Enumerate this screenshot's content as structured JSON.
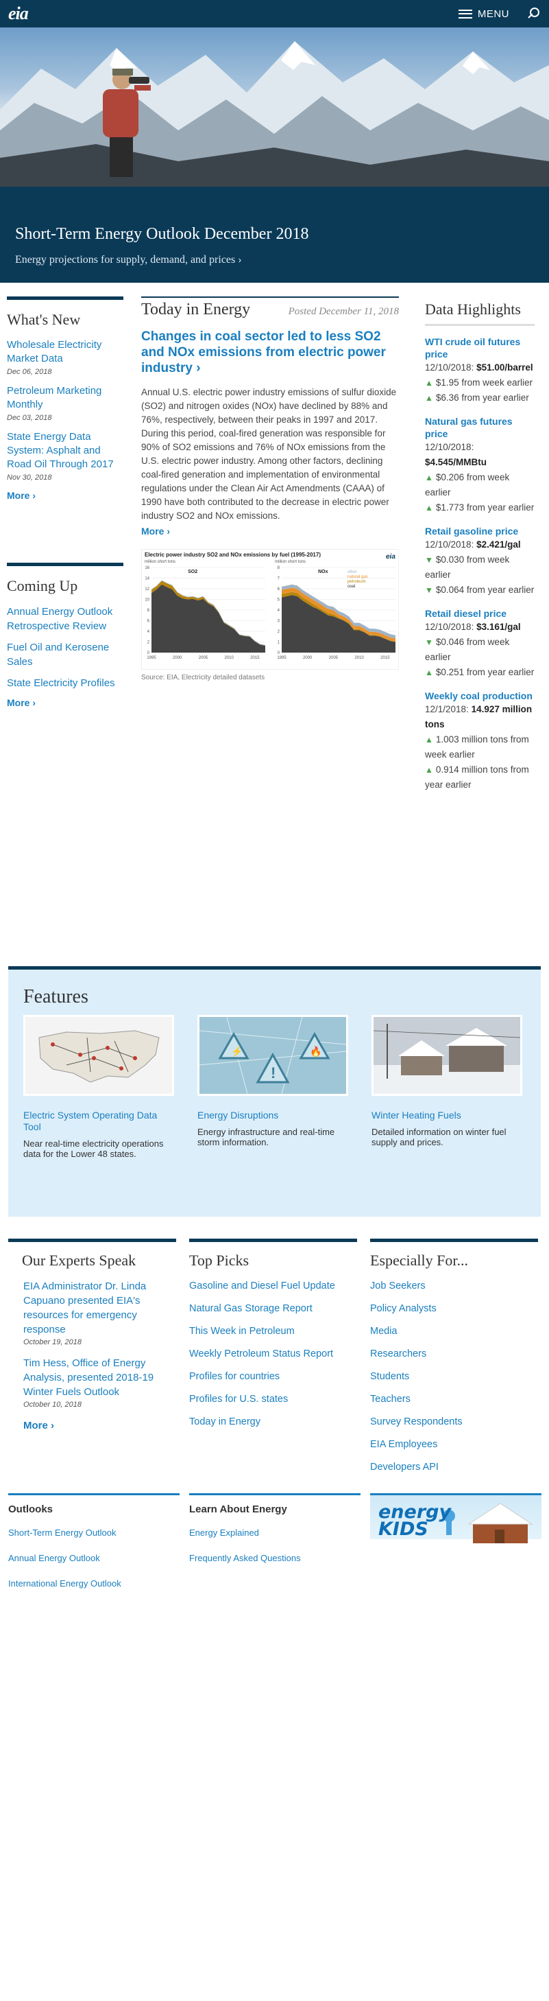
{
  "header": {
    "logo": "eia",
    "menu_label": "MENU"
  },
  "hero": {
    "title": "Short-Term Energy Outlook December 2018",
    "subtitle": "Energy projections for supply, demand, and prices ›",
    "slides": 6,
    "active_slide": 1
  },
  "whats_new": {
    "title": "What's New",
    "items": [
      {
        "label": "Wholesale Electricity Market Data",
        "date": "Dec 06, 2018"
      },
      {
        "label": "Petroleum Marketing Monthly",
        "date": "Dec 03, 2018"
      },
      {
        "label": "State Energy Data System: Asphalt and Road Oil Through 2017",
        "date": "Nov 30, 2018"
      }
    ],
    "more": "More ›"
  },
  "coming_up": {
    "title": "Coming Up",
    "items": [
      "Annual Energy Outlook Retrospective Review",
      "Fuel Oil and Kerosene Sales",
      "State Electricity Profiles"
    ],
    "more": "More ›"
  },
  "today": {
    "title": "Today in Energy",
    "posted": "Posted December 11, 2018",
    "headline": "Changes in coal sector led to less SO2 and NOx emissions from electric power industry ›",
    "body": "Annual U.S. electric power industry emissions of sulfur dioxide (SO2) and nitrogen oxides (NOx) have declined by 88% and 76%, respectively, between their peaks in 1997 and 2017. During this period, coal-fired generation was responsible for 90% of SO2 emissions and 76% of NOx emissions from the U.S. electric power industry. Among other factors, declining coal-fired generation and implementation of environmental regulations under the Clean Air Act Amendments (CAAA) of 1990 have both contributed to the decrease in electric power industry SO2 and NOx emissions.",
    "more": "More ›",
    "chart_title": "Electric power industry SO2 and NOx emissions by fuel (1995-2017)",
    "chart_units": "million short tons",
    "chart_logo": "eia",
    "source": "Source: EIA, Electricity detailed datasets",
    "panels": [
      {
        "label": "SO2",
        "yticks": [
          "16",
          "14",
          "12",
          "10",
          "8",
          "6",
          "4",
          "2",
          "0"
        ]
      },
      {
        "label": "NOx",
        "yticks": [
          "8",
          "7",
          "6",
          "5",
          "4",
          "3",
          "2",
          "1",
          "0"
        ]
      }
    ],
    "xticks": [
      "1995",
      "2000",
      "2005",
      "2010",
      "2015"
    ],
    "legend": [
      "other",
      "natural gas",
      "petroleum",
      "coal"
    ]
  },
  "chart_data": [
    {
      "type": "area",
      "title": "SO2",
      "x": [
        1995,
        1996,
        1997,
        1998,
        1999,
        2000,
        2001,
        2002,
        2003,
        2004,
        2005,
        2006,
        2007,
        2008,
        2009,
        2010,
        2011,
        2012,
        2013,
        2014,
        2015,
        2016,
        2017
      ],
      "ylim": [
        0,
        16
      ],
      "series": [
        {
          "name": "coal",
          "values": [
            11.2,
            11.9,
            12.8,
            12.3,
            11.9,
            10.7,
            10.2,
            10.0,
            10.1,
            9.8,
            10.1,
            9.2,
            8.7,
            7.5,
            5.6,
            5.0,
            4.4,
            3.3,
            3.1,
            3.0,
            2.1,
            1.5,
            1.3
          ]
        },
        {
          "name": "petroleum",
          "values": [
            0.6,
            0.6,
            0.7,
            0.7,
            0.7,
            0.6,
            0.5,
            0.4,
            0.4,
            0.4,
            0.4,
            0.2,
            0.2,
            0.1,
            0.1,
            0.1,
            0.1,
            0.05,
            0.05,
            0.05,
            0.04,
            0.03,
            0.03
          ]
        },
        {
          "name": "other",
          "values": [
            0.1,
            0.1,
            0.1,
            0.1,
            0.1,
            0.1,
            0.1,
            0.1,
            0.1,
            0.1,
            0.1,
            0.1,
            0.1,
            0.1,
            0.1,
            0.1,
            0.1,
            0.1,
            0.1,
            0.1,
            0.1,
            0.1,
            0.1
          ]
        }
      ]
    },
    {
      "type": "area",
      "title": "NOx",
      "x": [
        1995,
        1996,
        1997,
        1998,
        1999,
        2000,
        2001,
        2002,
        2003,
        2004,
        2005,
        2006,
        2007,
        2008,
        2009,
        2010,
        2011,
        2012,
        2013,
        2014,
        2015,
        2016,
        2017
      ],
      "ylim": [
        0,
        8
      ],
      "series": [
        {
          "name": "coal",
          "values": [
            5.2,
            5.3,
            5.4,
            5.3,
            4.9,
            4.6,
            4.3,
            4.1,
            3.8,
            3.5,
            3.4,
            3.2,
            3.0,
            2.7,
            2.1,
            2.1,
            1.9,
            1.6,
            1.6,
            1.5,
            1.3,
            1.1,
            1.0
          ]
        },
        {
          "name": "petroleum",
          "values": [
            0.3,
            0.3,
            0.3,
            0.3,
            0.3,
            0.3,
            0.3,
            0.2,
            0.2,
            0.2,
            0.2,
            0.1,
            0.1,
            0.1,
            0.1,
            0.1,
            0.05,
            0.05,
            0.05,
            0.05,
            0.04,
            0.03,
            0.03
          ]
        },
        {
          "name": "natural gas",
          "values": [
            0.4,
            0.4,
            0.4,
            0.4,
            0.4,
            0.4,
            0.4,
            0.4,
            0.4,
            0.4,
            0.4,
            0.3,
            0.3,
            0.3,
            0.3,
            0.3,
            0.3,
            0.3,
            0.3,
            0.3,
            0.3,
            0.3,
            0.3
          ]
        },
        {
          "name": "other",
          "values": [
            0.3,
            0.3,
            0.3,
            0.3,
            0.3,
            0.3,
            0.3,
            0.3,
            0.3,
            0.3,
            0.3,
            0.3,
            0.3,
            0.3,
            0.3,
            0.3,
            0.3,
            0.3,
            0.3,
            0.3,
            0.3,
            0.3,
            0.3
          ]
        }
      ]
    }
  ],
  "data_highlights": {
    "title": "Data Highlights",
    "items": [
      {
        "name": "WTI crude oil futures price",
        "lines": [
          {
            "text": "12/10/2018: ",
            "bold": "$51.00/barrel"
          },
          {
            "arrow": "▲",
            "text": "$1.95 from week earlier"
          },
          {
            "arrow": "▲",
            "text": "$6.36 from year earlier"
          }
        ]
      },
      {
        "name": "Natural gas futures price",
        "lines": [
          {
            "text": "12/10/2018: ",
            "bold": "$4.545/MMBtu"
          },
          {
            "arrow": "▲",
            "text": "$0.206 from week earlier"
          },
          {
            "arrow": "▲",
            "text": "$1.773 from year earlier"
          }
        ]
      },
      {
        "name": "Retail gasoline price",
        "lines": [
          {
            "text": "12/10/2018: ",
            "bold": "$2.421/gal"
          },
          {
            "arrow": "▼",
            "text": "$0.030 from week earlier"
          },
          {
            "arrow": "▼",
            "text": "$0.064 from year earlier"
          }
        ]
      },
      {
        "name": "Retail diesel price",
        "lines": [
          {
            "text": "12/10/2018: ",
            "bold": "$3.161/gal"
          },
          {
            "arrow": "▼",
            "text": "$0.046 from week earlier"
          },
          {
            "arrow": "▲",
            "text": "$0.251 from year earlier"
          }
        ]
      },
      {
        "name": "Weekly coal production",
        "lines": [
          {
            "text": "12/1/2018: ",
            "bold": "14.927 million tons"
          },
          {
            "arrow": "▲",
            "text": "1.003 million tons from week earlier"
          },
          {
            "arrow": "▲",
            "text": "0.914 million tons from year earlier"
          }
        ]
      }
    ]
  },
  "features": {
    "title": "Features",
    "items": [
      {
        "name": "Electric System Operating Data Tool",
        "desc": "Near real-time electricity operations data for the Lower 48 states."
      },
      {
        "name": "Energy Disruptions",
        "desc": "Energy infrastructure and real-time storm information."
      },
      {
        "name": "Winter Heating Fuels",
        "desc": "Detailed information on winter fuel supply and prices."
      }
    ]
  },
  "experts": {
    "title": "Our Experts Speak",
    "items": [
      {
        "label": "EIA Administrator Dr. Linda Capuano presented EIA's resources for emergency response",
        "date": "October 19, 2018"
      },
      {
        "label": "Tim Hess, Office of Energy Analysis, presented 2018-19 Winter Fuels Outlook",
        "date": "October 10, 2018"
      }
    ],
    "more": "More ›"
  },
  "top_picks": {
    "title": "Top Picks",
    "items": [
      "Gasoline and Diesel Fuel Update",
      "Natural Gas Storage Report",
      "This Week in Petroleum",
      "Weekly Petroleum Status Report",
      "Profiles for countries",
      "Profiles for U.S. states",
      "Today in Energy"
    ]
  },
  "especially": {
    "title": "Especially For...",
    "items": [
      "Job Seekers",
      "Policy Analysts",
      "Media",
      "Researchers",
      "Students",
      "Teachers",
      "Survey Respondents",
      "EIA Employees",
      "Developers API"
    ]
  },
  "footer": {
    "outlooks": {
      "title": "Outlooks",
      "items": [
        "Short-Term Energy Outlook",
        "Annual Energy Outlook",
        "International Energy Outlook"
      ]
    },
    "learn": {
      "title": "Learn About Energy",
      "items": [
        "Energy Explained",
        "Frequently Asked Questions"
      ]
    },
    "kids": {
      "label": "energy KIDS"
    }
  },
  "colors": {
    "navy": "#0b3a57",
    "link": "#1a7fbf",
    "features_bg": "#dceefa",
    "dot_active": "#f1c416",
    "coal": "#444444",
    "petroleum": "#b8860b",
    "natural_gas": "#e8922c",
    "other": "#9fb3c8"
  }
}
